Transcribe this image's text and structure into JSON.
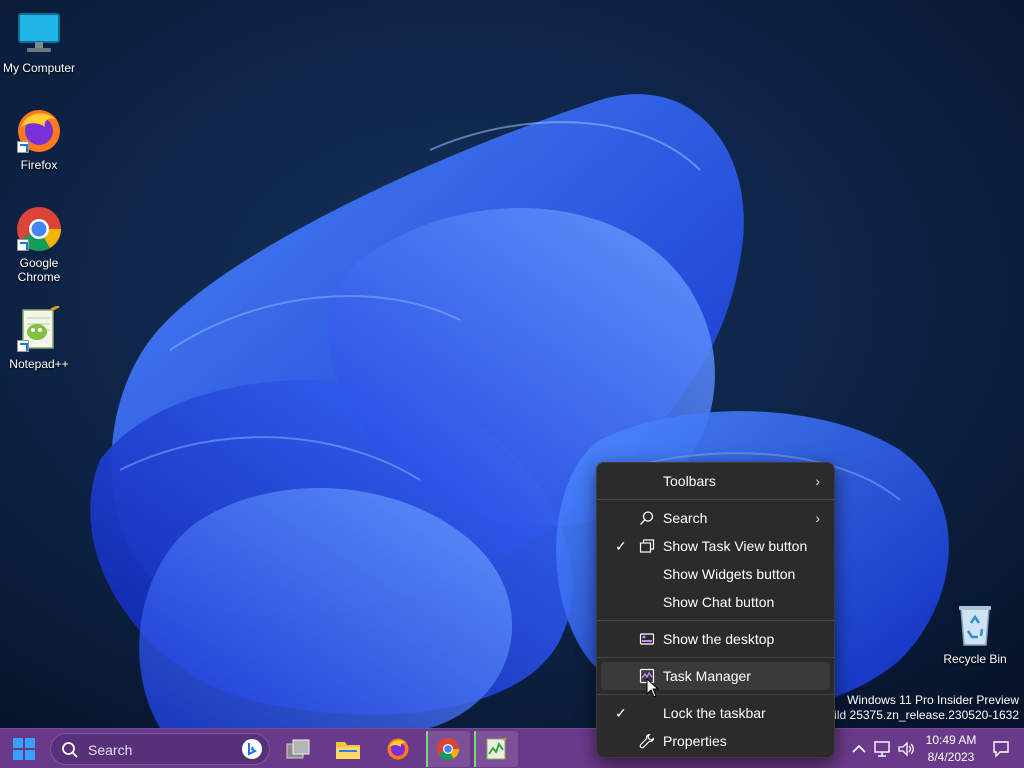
{
  "desktop": {
    "icons": [
      {
        "label": "My Computer",
        "icon": "monitor-icon"
      },
      {
        "label": "Firefox",
        "icon": "firefox-icon"
      },
      {
        "label": "Google Chrome",
        "icon": "chrome-icon"
      },
      {
        "label": "Notepad++",
        "icon": "notepadpp-icon"
      },
      {
        "label": "Recycle Bin",
        "icon": "recycle-bin-icon"
      }
    ],
    "watermark": {
      "line1": "Windows 11 Pro Insider Preview",
      "line2": "Build 25375.zn_release.230520-1632"
    }
  },
  "context_menu": {
    "items": [
      {
        "label": "Toolbars",
        "checked": false,
        "icon": "",
        "submenu": true
      },
      {
        "label": "Search",
        "checked": false,
        "icon": "search-icon",
        "submenu": true
      },
      {
        "label": "Show Task View button",
        "checked": true,
        "icon": "task-view-icon",
        "submenu": false
      },
      {
        "label": "Show Widgets button",
        "checked": false,
        "icon": "",
        "submenu": false
      },
      {
        "label": "Show Chat button",
        "checked": false,
        "icon": "",
        "submenu": false
      },
      {
        "label": "Show the desktop",
        "checked": false,
        "icon": "desktop-icon",
        "submenu": false
      },
      {
        "label": "Task Manager",
        "checked": false,
        "icon": "task-manager-icon",
        "submenu": false,
        "hovered": true
      },
      {
        "label": "Lock the taskbar",
        "checked": true,
        "icon": "",
        "submenu": false
      },
      {
        "label": "Properties",
        "checked": false,
        "icon": "wrench-icon",
        "submenu": false
      }
    ],
    "check_glyph": "✓",
    "arrow_glyph": "›"
  },
  "taskbar": {
    "search_label": "Search",
    "apps": [
      "task-view-icon",
      "file-explorer-icon",
      "firefox-icon",
      "chrome-icon",
      "taskmgr-icon"
    ],
    "clock": {
      "time": "10:49 AM",
      "date": "8/4/2023"
    },
    "accent": "#6a3a8a"
  }
}
